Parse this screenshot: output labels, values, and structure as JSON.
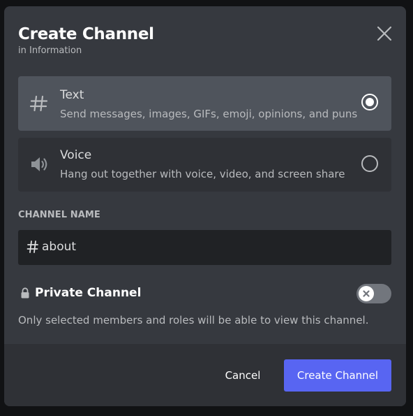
{
  "modal": {
    "title": "Create Channel",
    "subtitle": "in Information"
  },
  "channel_types": [
    {
      "label": "Text",
      "description": "Send messages, images, GIFs, emoji, opinions, and puns",
      "icon": "hashtag-icon",
      "selected": true
    },
    {
      "label": "Voice",
      "description": "Hang out together with voice, video, and screen share",
      "icon": "speaker-icon",
      "selected": false
    }
  ],
  "channel_name": {
    "section_label": "CHANNEL NAME",
    "prefix_icon": "hashtag-icon",
    "value": "about"
  },
  "private": {
    "label": "Private Channel",
    "description": "Only selected members and roles will be able to view this channel.",
    "enabled": false,
    "icon": "lock-icon"
  },
  "footer": {
    "cancel_label": "Cancel",
    "create_label": "Create Channel"
  },
  "colors": {
    "modal_bg": "#36393f",
    "footer_bg": "#2f3136",
    "selected_option_bg": "#4f545c",
    "input_bg": "#202225",
    "accent": "#5865f2",
    "toggle_off": "#72767d"
  }
}
